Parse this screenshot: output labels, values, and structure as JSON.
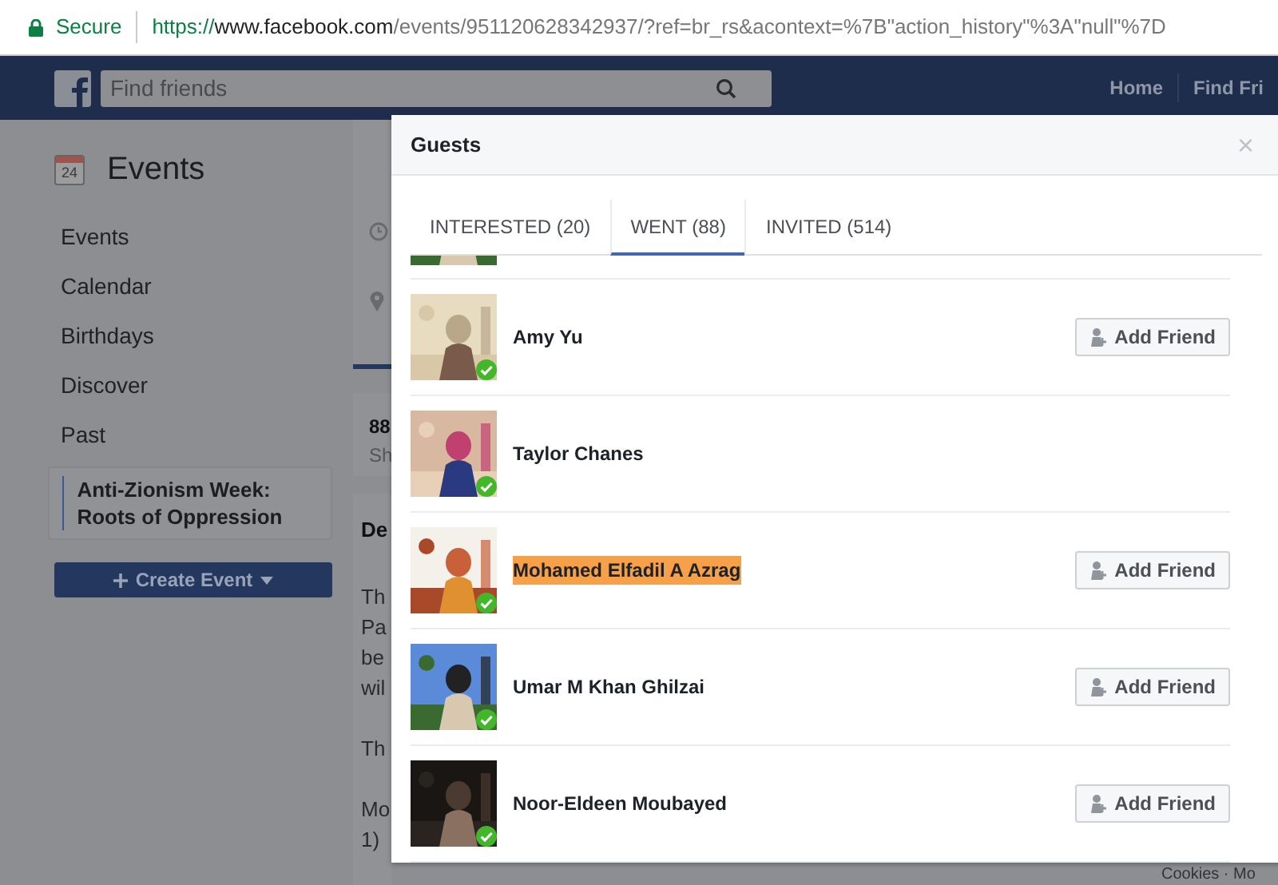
{
  "browser": {
    "secure_label": "Secure",
    "url_scheme": "https://",
    "url_host": "www.facebook.com",
    "url_path": "/events/951120628342937/?ref=br_rs&acontext=%7B\"action_history\"%3A\"null\"%7D"
  },
  "header": {
    "search": {
      "placeholder": "Find friends"
    },
    "nav": [
      "Home",
      "Find Fri"
    ]
  },
  "sidebar": {
    "title": "Events",
    "calendar_day": "24",
    "items": [
      {
        "label": "Events",
        "selected": false
      },
      {
        "label": "Calendar",
        "selected": false
      },
      {
        "label": "Birthdays",
        "selected": false
      },
      {
        "label": "Discover",
        "selected": false
      },
      {
        "label": "Past",
        "selected": false
      },
      {
        "label": "Anti-Zionism Week: Roots of Oppression",
        "selected": true
      }
    ],
    "create_button": "Create Event"
  },
  "event_page": {
    "stat_count": "88",
    "stat_label": "Sh",
    "details_heading": "De",
    "details_paragraphs": [
      [
        "Th",
        "Pa",
        "be",
        "wil"
      ],
      [
        "Th"
      ],
      [
        "Mo",
        "1)"
      ]
    ],
    "footer": "Cookies · Mo"
  },
  "guests_dialog": {
    "title": "Guests",
    "close": "×",
    "tabs": [
      {
        "label": "INTERESTED (20)",
        "selected": false
      },
      {
        "label": "WENT (88)",
        "selected": true
      },
      {
        "label": "INVITED (514)",
        "selected": false
      }
    ],
    "guests": [
      {
        "name": "Amy Yu",
        "went": true,
        "highlighted": false,
        "button": "Add Friend"
      },
      {
        "name": "Taylor Chanes",
        "went": true,
        "highlighted": false
      },
      {
        "name": "Mohamed Elfadil A Azrag",
        "went": true,
        "highlighted": true,
        "button": "Add Friend"
      },
      {
        "name": "Umar M Khan Ghilzai",
        "went": true,
        "highlighted": false,
        "button": "Add Friend"
      },
      {
        "name": "Noor-Eldeen Moubayed",
        "went": true,
        "highlighted": false,
        "button": "Add Friend"
      }
    ]
  }
}
